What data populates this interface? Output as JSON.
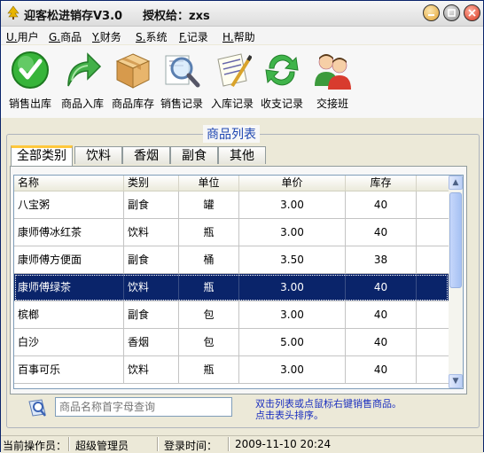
{
  "window": {
    "title": "迎客松进销存V3.0",
    "license_label": "授权给：zxs"
  },
  "menu": [
    {
      "key": "U.",
      "label": "用户"
    },
    {
      "key": "G.",
      "label": "商品"
    },
    {
      "key": "Y.",
      "label": "财务"
    },
    {
      "key": "S.",
      "label": "系统"
    },
    {
      "key": "F.",
      "label": "记录"
    },
    {
      "key": "H.",
      "label": "帮助"
    }
  ],
  "toolbar": [
    {
      "label": "销售出库",
      "icon": "checkmark-icon"
    },
    {
      "label": "商品入库",
      "icon": "green-arrow-icon"
    },
    {
      "label": "商品库存",
      "icon": "box-icon"
    },
    {
      "label": "销售记录",
      "icon": "magnifier-icon"
    },
    {
      "label": "入库记录",
      "icon": "notepad-icon"
    },
    {
      "label": "收支记录",
      "icon": "refresh-icon"
    },
    {
      "label": "交接班",
      "icon": "users-icon"
    }
  ],
  "product_list": {
    "title": "商品列表",
    "tabs": [
      "全部类别",
      "饮料",
      "香烟",
      "副食",
      "其他"
    ],
    "active_tab": 0,
    "columns": [
      "名称",
      "类别",
      "单位",
      "单价",
      "库存"
    ],
    "rows": [
      [
        "八宝粥",
        "副食",
        "罐",
        "3.00",
        "40"
      ],
      [
        "康师傅冰红茶",
        "饮料",
        "瓶",
        "3.00",
        "40"
      ],
      [
        "康师傅方便面",
        "副食",
        "桶",
        "3.50",
        "38"
      ],
      [
        "康师傅绿茶",
        "饮料",
        "瓶",
        "3.00",
        "40"
      ],
      [
        "槟榔",
        "副食",
        "包",
        "3.00",
        "40"
      ],
      [
        "白沙",
        "香烟",
        "包",
        "5.00",
        "40"
      ],
      [
        "百事可乐",
        "饮料",
        "瓶",
        "3.00",
        "40"
      ]
    ],
    "selected_row": 3
  },
  "search": {
    "placeholder": "商品名称首字母查询",
    "hint_line1": "双击列表或点鼠标右键销售商品。",
    "hint_line2": "点击表头排序。"
  },
  "status": {
    "operator_label": "当前操作员：",
    "operator_value": "超级管理员",
    "login_label": "登录时间：",
    "login_value": "2009-11-10 20:24"
  },
  "colors": {
    "selection": "#0a246a",
    "group_title": "#1f47b2",
    "hint": "#1b2fbf",
    "active_tab_accent": "#ffc83c"
  }
}
